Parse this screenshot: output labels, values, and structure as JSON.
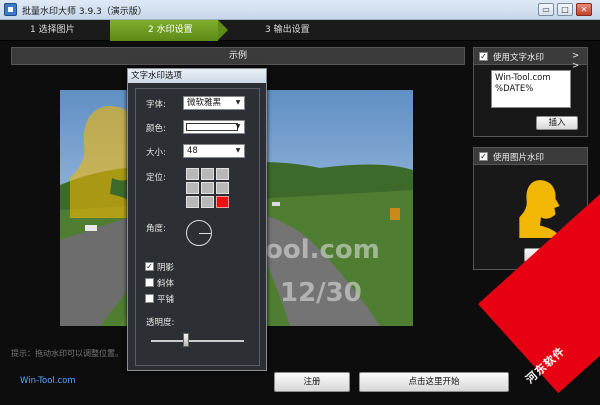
{
  "window": {
    "title": "批量水印大师 3.9.3（演示版）",
    "minimize_glyph": "▭",
    "maximize_glyph": "□",
    "close_glyph": "✕"
  },
  "steps": [
    {
      "label": "1 选择图片",
      "active": false
    },
    {
      "label": "2 水印设置",
      "active": true
    },
    {
      "label": "3 输出设置",
      "active": false
    }
  ],
  "preview": {
    "header": "示例",
    "watermark_line1": "ool.com",
    "watermark_line2": "12/30",
    "hint": "提示：拖动水印可以调整位置。"
  },
  "dialog": {
    "title": "文字水印选项",
    "font_label": "字体:",
    "font_value": "微软雅黑",
    "color_label": "颜色:",
    "color_value": "#ffffff",
    "size_label": "大小:",
    "size_value": "48",
    "position_label": "定位:",
    "position_selected_index": 8,
    "angle_label": "角度:",
    "shadow_label": "阴影",
    "shadow_checked": true,
    "italic_label": "斜体",
    "italic_checked": false,
    "tile_label": "平铺",
    "tile_checked": false,
    "opacity_label": "透明度:",
    "opacity_level": 0.38
  },
  "text_panel": {
    "enabled": true,
    "title": "使用文字水印",
    "expand_glyph": "> >",
    "text_line1": "Win-Tool.com",
    "text_line2": "%DATE%",
    "insert_button": "插入"
  },
  "image_panel": {
    "enabled": true,
    "title": "使用图片水印",
    "choose_button": "选择..."
  },
  "footer": {
    "link": "Win-Tool.com",
    "register_button": "注册",
    "next_button": "点击这里开始",
    "brand": "河东软件"
  },
  "colors": {
    "step_active": "#6e9f22",
    "logo_yellow": "#f2b705",
    "badge_red": "#e60012"
  },
  "icons": [
    "app-icon",
    "minimize-icon",
    "maximize-icon",
    "close-icon",
    "dropdown-arrow-icon",
    "silhouette-logo-icon"
  ]
}
